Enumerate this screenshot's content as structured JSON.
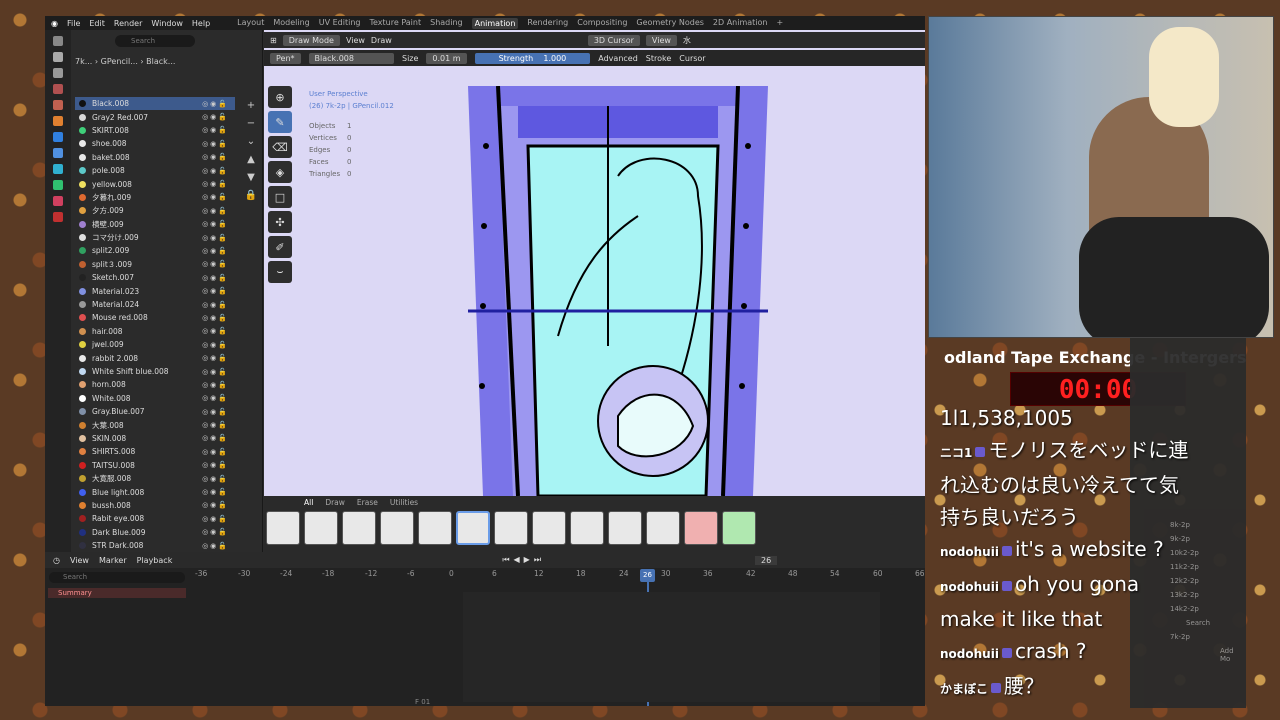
{
  "menu": {
    "items": [
      "File",
      "Edit",
      "Render",
      "Window",
      "Help"
    ],
    "workspaces": [
      "Layout",
      "Modeling",
      "UV Editing",
      "Texture Paint",
      "Shading",
      "Animation",
      "Rendering",
      "Compositing",
      "Geometry Nodes",
      "2D Animation"
    ],
    "active_workspace": "Animation"
  },
  "outliner": {
    "search_placeholder": "Search",
    "breadcrumb": [
      "7k...",
      "GPencil...",
      "Black..."
    ],
    "materials": [
      {
        "name": "Black.008",
        "color": "#111111"
      },
      {
        "name": "Gray2 Red.007",
        "color": "#d9d9d9"
      },
      {
        "name": "SKIRT.008",
        "color": "#3fd07a"
      },
      {
        "name": "shoe.008",
        "color": "#e8e8e8"
      },
      {
        "name": "baket.008",
        "color": "#e8e8e8"
      },
      {
        "name": "pole.008",
        "color": "#5cc8c8"
      },
      {
        "name": "yellow.008",
        "color": "#f0e060"
      },
      {
        "name": "夕暮れ.009",
        "color": "#e06a30"
      },
      {
        "name": "夕方.009",
        "color": "#e0a040"
      },
      {
        "name": "横壁.009",
        "color": "#a080d0"
      },
      {
        "name": "コマ分け.009",
        "color": "#e0e0e0"
      },
      {
        "name": "split2.009",
        "color": "#30a060"
      },
      {
        "name": "split３.009",
        "color": "#c06030"
      },
      {
        "name": "Sketch.007",
        "color": "#222222"
      },
      {
        "name": "Material.023",
        "color": "#8090e0"
      },
      {
        "name": "Material.024",
        "color": "#9a9a9a"
      },
      {
        "name": "Mouse red.008",
        "color": "#e05050"
      },
      {
        "name": "hair.008",
        "color": "#d09050"
      },
      {
        "name": "jwel.009",
        "color": "#e0d040"
      },
      {
        "name": "rabbit 2.008",
        "color": "#e8e8e8"
      },
      {
        "name": "White Shift blue.008",
        "color": "#c0d8f0"
      },
      {
        "name": "horn.008",
        "color": "#e0a070"
      },
      {
        "name": "White.008",
        "color": "#ffffff"
      },
      {
        "name": "Gray.Blue.007",
        "color": "#8090a8"
      },
      {
        "name": "大葉.008",
        "color": "#d08030"
      },
      {
        "name": "SKIN.008",
        "color": "#e0c0a0"
      },
      {
        "name": "SHIRTS.008",
        "color": "#e08040"
      },
      {
        "name": "TAITSU.008",
        "color": "#d02020"
      },
      {
        "name": "大寛服.008",
        "color": "#c0a030"
      },
      {
        "name": "Blue light.008",
        "color": "#4060f0"
      },
      {
        "name": "bussh.008",
        "color": "#e08030"
      },
      {
        "name": "Rabit eye.008",
        "color": "#a02020"
      },
      {
        "name": "Dark Blue.009",
        "color": "#203080"
      },
      {
        "name": "STR Dark.008",
        "color": "#303040"
      }
    ]
  },
  "viewport": {
    "mode": "Draw Mode",
    "menus": [
      "View",
      "Draw"
    ],
    "orientation": "3D Cursor",
    "view_label": "View",
    "brush": "Pen*",
    "material": "Black.008",
    "size_label": "Size",
    "size_value": "0.01 m",
    "strength_label": "Strength",
    "strength_value": "1.000",
    "right_menus": [
      "Advanced",
      "Stroke",
      "Cursor"
    ],
    "overlay_line1": "User Perspective",
    "overlay_line2": "(26) 7k-2p | GPencil.012",
    "stats": [
      {
        "k": "Objects",
        "v": "1"
      },
      {
        "k": "Vertices",
        "v": "0"
      },
      {
        "k": "Edges",
        "v": "0"
      },
      {
        "k": "Faces",
        "v": "0"
      },
      {
        "k": "Triangles",
        "v": "0"
      }
    ],
    "brush_tabs": [
      "All",
      "Draw",
      "Erase",
      "Utilities"
    ]
  },
  "timeline": {
    "menus": [
      "View",
      "Marker",
      "Playback"
    ],
    "search_placeholder": "Search",
    "summary": "Summary",
    "current_frame": "26",
    "ticks": [
      "-36",
      "-30",
      "-24",
      "-18",
      "-12",
      "-6",
      "0",
      "6",
      "12",
      "18",
      "24",
      "30",
      "36",
      "42",
      "48",
      "54",
      "60",
      "66"
    ],
    "frame_bottom": "F 01"
  },
  "stream": {
    "title": "odland Tape Exchange - Intergers",
    "timer": "00:00",
    "chat": [
      {
        "user": "",
        "text": "1l1,538,1005"
      },
      {
        "user": "ニコ1",
        "text": "モノリスをベッドに連"
      },
      {
        "user": "",
        "text": "れ込むのは良い冷えてて気"
      },
      {
        "user": "",
        "text": "持ち良いだろう"
      },
      {
        "user": "nodohuii",
        "text": "it's a website ?"
      },
      {
        "user": "nodohuii",
        "text": "oh you gona"
      },
      {
        "user": "",
        "text": "make it like that"
      },
      {
        "user": "nodohuii",
        "text": "crash ?"
      },
      {
        "user": "かまぼこ",
        "text": "腰？"
      }
    ]
  },
  "right_panel": {
    "items": [
      "8k-2p",
      "9k-2p",
      "10k2-2p",
      "11k2-2p",
      "12k2-2p",
      "13k2-2p",
      "14k2-2p"
    ],
    "bottom_item": "7k-2p",
    "search_placeholder": "Search",
    "add_label": "Add Mo"
  }
}
